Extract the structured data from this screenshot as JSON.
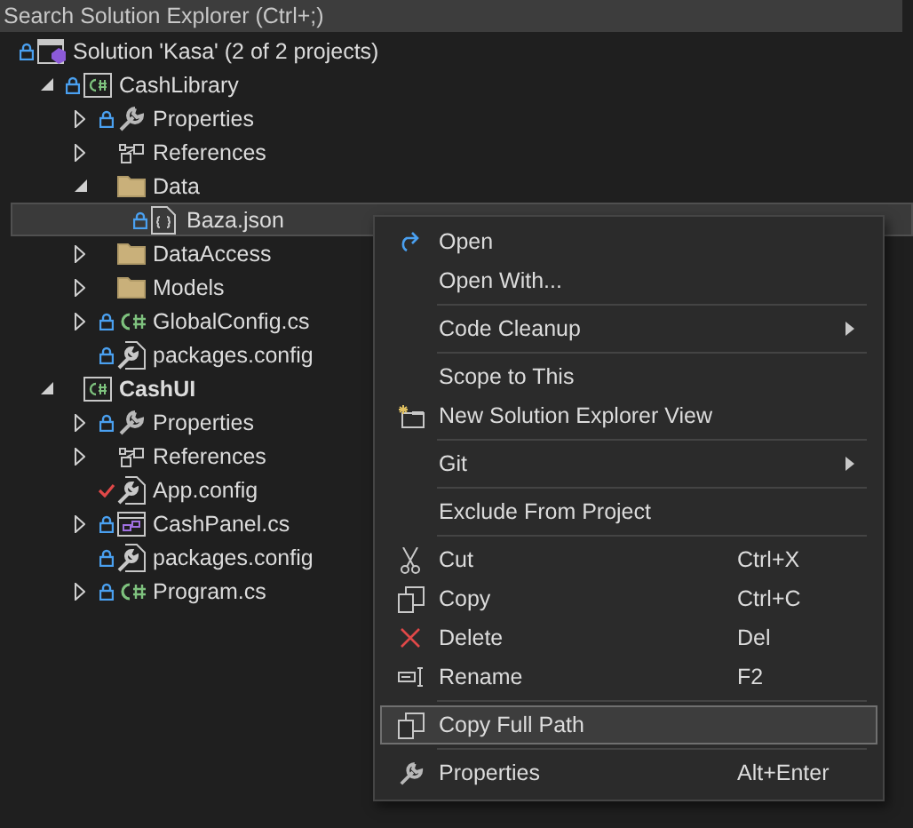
{
  "search": {
    "placeholder": "Search Solution Explorer (Ctrl+;)"
  },
  "tree": [
    {
      "label": "Solution 'Kasa' (2 of 2 projects)",
      "kind": "solution",
      "locked": true,
      "selected": false,
      "children": [
        {
          "label": "CashLibrary",
          "kind": "project",
          "startup": false,
          "locked": true,
          "selected": false,
          "expanded": true,
          "children": [
            {
              "label": "Properties",
              "kind": "properties",
              "locked": true,
              "selected": false,
              "expanded": false
            },
            {
              "label": "References",
              "kind": "references",
              "selected": false,
              "expanded": false
            },
            {
              "label": "Data",
              "kind": "folder",
              "selected": false,
              "expanded": true,
              "children": [
                {
                  "label": "Baza.json",
                  "kind": "json",
                  "locked": true,
                  "selected": true
                }
              ]
            },
            {
              "label": "DataAccess",
              "kind": "folder",
              "selected": false,
              "expanded": false
            },
            {
              "label": "Models",
              "kind": "folder",
              "selected": false,
              "expanded": false
            },
            {
              "label": "GlobalConfig.cs",
              "kind": "code",
              "locked": true,
              "selected": false,
              "expanded": false
            },
            {
              "label": "packages.config",
              "kind": "config",
              "locked": true,
              "selected": false
            }
          ]
        },
        {
          "label": "CashUI",
          "kind": "project",
          "startup": true,
          "selected": false,
          "expanded": true,
          "children": [
            {
              "label": "Properties",
              "kind": "properties",
              "locked": true,
              "selected": false,
              "expanded": false
            },
            {
              "label": "References",
              "kind": "references",
              "selected": false,
              "expanded": false
            },
            {
              "label": "App.config",
              "kind": "config",
              "edited": true,
              "selected": false
            },
            {
              "label": "CashPanel.cs",
              "kind": "form",
              "locked": true,
              "selected": false,
              "expanded": false
            },
            {
              "label": "packages.config",
              "kind": "config",
              "locked": true,
              "selected": false
            },
            {
              "label": "Program.cs",
              "kind": "code",
              "locked": true,
              "selected": false,
              "expanded": false
            }
          ]
        }
      ]
    }
  ],
  "context_menu": [
    {
      "kind": "item",
      "label": "Open",
      "selected": false
    },
    {
      "kind": "item",
      "label": "Open With...",
      "selected": false
    },
    {
      "kind": "separator"
    },
    {
      "kind": "item",
      "label": "Code Cleanup",
      "submenu": true,
      "selected": false
    },
    {
      "kind": "separator"
    },
    {
      "kind": "item",
      "label": "Scope to This",
      "selected": false
    },
    {
      "kind": "item",
      "label": "New Solution Explorer View",
      "selected": false
    },
    {
      "kind": "separator"
    },
    {
      "kind": "item",
      "label": "Git",
      "submenu": true,
      "selected": false
    },
    {
      "kind": "separator"
    },
    {
      "kind": "item",
      "label": "Exclude From Project",
      "selected": false
    },
    {
      "kind": "separator"
    },
    {
      "kind": "item",
      "label": "Cut",
      "shortcut": "Ctrl+X",
      "selected": false
    },
    {
      "kind": "item",
      "label": "Copy",
      "shortcut": "Ctrl+C",
      "selected": false
    },
    {
      "kind": "item",
      "label": "Delete",
      "shortcut": "Del",
      "selected": false
    },
    {
      "kind": "item",
      "label": "Rename",
      "shortcut": "F2",
      "selected": false
    },
    {
      "kind": "separator"
    },
    {
      "kind": "item",
      "label": "Copy Full Path",
      "selected": true
    },
    {
      "kind": "separator"
    },
    {
      "kind": "item",
      "label": "Properties",
      "shortcut": "Alt+Enter",
      "selected": false
    }
  ]
}
